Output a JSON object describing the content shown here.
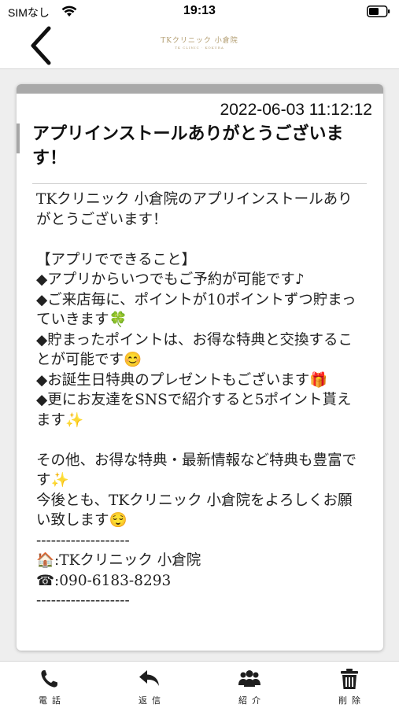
{
  "status_bar": {
    "carrier": "SIMなし",
    "time": "19:13",
    "wifi_icon": "wifi-icon",
    "battery_icon": "battery-icon"
  },
  "nav": {
    "back_icon": "chevron-left-icon",
    "logo_title": "TKクリニック 小倉院",
    "logo_subtitle": "TK CLINIC · KOKURA"
  },
  "message": {
    "date": "2022-06-03 11:12:12",
    "title": "アプリインストールありがとうございます！",
    "body": "TKクリニック 小倉院のアプリインストールありがとうございます！\n\n【アプリでできること】\n◆アプリからいつでもご予約が可能です♪\n◆ご来店毎に、ポイントが10ポイントずつ貯まっていきます🍀\n◆貯まったポイントは、お得な特典と交換することが可能です😊\n◆お誕生日特典のプレゼントもございます🎁\n◆更にお友達をSNSで紹介すると5ポイント貰えます✨\n\nその他、お得な特典・最新情報など特典も豊富です✨\n今後とも、TKクリニック 小倉院をよろしくお願い致します😌\n-------------------\n🏠:TKクリニック 小倉院\n☎:090-6183-8293\n-------------------"
  },
  "toolbar": {
    "items": [
      {
        "label": "電話",
        "icon": "phone-icon"
      },
      {
        "label": "返信",
        "icon": "reply-icon"
      },
      {
        "label": "紹介",
        "icon": "users-icon"
      },
      {
        "label": "削除",
        "icon": "trash-icon"
      }
    ]
  },
  "colors": {
    "header_bg": "#ffffff",
    "page_bg": "#eeeeee",
    "card_topbar": "#a9a9a9",
    "logo_gold": "#b09a6c",
    "icon_dark": "#1e1e1e"
  }
}
